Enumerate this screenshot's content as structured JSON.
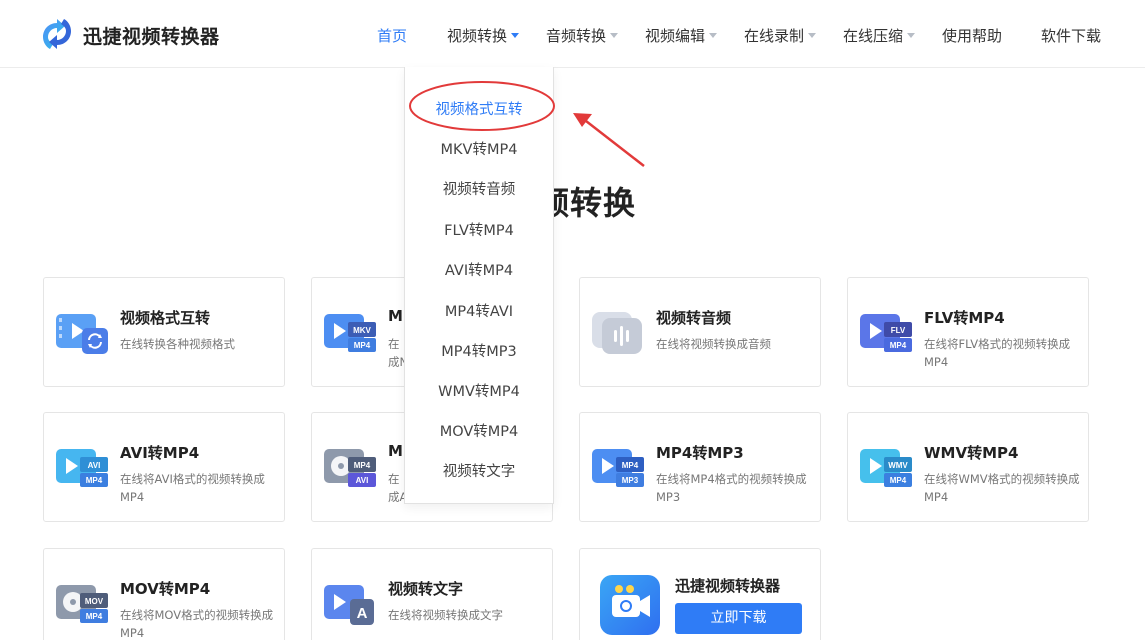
{
  "brand": {
    "name": "迅捷视频转换器"
  },
  "nav": {
    "items": [
      {
        "label": "首页",
        "active": true,
        "dropdown": false
      },
      {
        "label": "视频转换",
        "active": false,
        "dropdown": true,
        "open": true
      },
      {
        "label": "音频转换",
        "active": false,
        "dropdown": true
      },
      {
        "label": "视频编辑",
        "active": false,
        "dropdown": true
      },
      {
        "label": "在线录制",
        "active": false,
        "dropdown": true
      },
      {
        "label": "在线压缩",
        "active": false,
        "dropdown": true
      },
      {
        "label": "使用帮助",
        "active": false,
        "dropdown": false
      },
      {
        "label": "软件下载",
        "active": false,
        "dropdown": false
      }
    ]
  },
  "dropdown": {
    "items": [
      {
        "label": "视频格式互转",
        "highlighted": true
      },
      {
        "label": "MKV转MP4"
      },
      {
        "label": "视频转音频"
      },
      {
        "label": "FLV转MP4"
      },
      {
        "label": "AVI转MP4"
      },
      {
        "label": "MP4转AVI"
      },
      {
        "label": "MP4转MP3"
      },
      {
        "label": "WMV转MP4"
      },
      {
        "label": "MOV转MP4"
      },
      {
        "label": "视频转文字"
      }
    ]
  },
  "hero": {
    "title_visible": "频转换"
  },
  "cards": [
    {
      "title": "视频格式互转",
      "desc": "在线转换各种视频格式",
      "icon": "video-sync-icon"
    },
    {
      "title": "M",
      "desc_lines": [
        "在",
        "成N"
      ],
      "icon": "mkv-mp4-icon",
      "badges": [
        "MKV",
        "MP4"
      ]
    },
    {
      "title": "视频转音频",
      "desc": "在线将视频转换成音频",
      "icon": "audio-wave-icon"
    },
    {
      "title": "FLV转MP4",
      "desc": "在线将FLV格式的视频转换成MP4",
      "icon": "flv-mp4-icon",
      "badges": [
        "FLV",
        "MP4"
      ]
    },
    {
      "title": "AVI转MP4",
      "desc": "在线将AVI格式的视频转换成MP4",
      "icon": "avi-mp4-icon",
      "badges": [
        "AVI",
        "MP4"
      ]
    },
    {
      "title": "M",
      "desc_lines": [
        "在",
        "成A"
      ],
      "icon": "mp4-avi-icon",
      "badges": [
        "MP4",
        "AVI"
      ]
    },
    {
      "title": "MP4转MP3",
      "desc": "在线将MP4格式的视频转换成MP3",
      "icon": "mp4-mp3-icon",
      "badges": [
        "MP4",
        "MP3"
      ]
    },
    {
      "title": "WMV转MP4",
      "desc": "在线将WMV格式的视频转换成MP4",
      "icon": "wmv-mp4-icon",
      "badges": [
        "WMV",
        "MP4"
      ]
    },
    {
      "title": "MOV转MP4",
      "desc": "在线将MOV格式的视频转换成MP4",
      "icon": "mov-mp4-icon",
      "badges": [
        "MOV",
        "MP4"
      ]
    },
    {
      "title": "视频转文字",
      "desc": "在线将视频转换成文字",
      "icon": "video-text-icon"
    }
  ],
  "download_card": {
    "title": "迅捷视频转换器",
    "button": "立即下载",
    "icon": "app-camera-icon"
  },
  "colors": {
    "accent": "#2f7cf6",
    "annotation": "#e23a3a"
  }
}
